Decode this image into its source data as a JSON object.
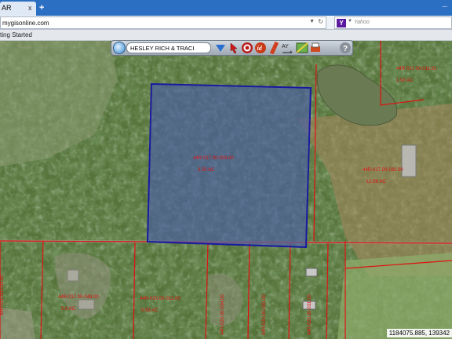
{
  "browser": {
    "tab_title": "AR",
    "tab_close": "x",
    "new_tab": "+",
    "url": "mygisonline.com",
    "search_engine_badge": "Y",
    "search_placeholder": "Yahoo",
    "bookmark_item": "ting Started"
  },
  "toolbar": {
    "search_value": "HESLEY RICH & TRACI",
    "icons": [
      "search-icon",
      "pointer-icon",
      "identify-target-icon",
      "identify-id-icon",
      "measure-ruler-icon",
      "label-ay-icon",
      "layers-map-icon",
      "print-icon",
      "help-icon"
    ],
    "help_label": "?",
    "id_label": "id"
  },
  "map": {
    "coordinates": "1184075.885, 139342",
    "parcel_labels": [
      {
        "id": "44R-017.00-004.00",
        "acres": "3.50 AC"
      },
      {
        "id": "44R-017.00-011.01",
        "acres": "1.92 AC"
      },
      {
        "id": "44R-017.00-032.00",
        "acres": "12.56 AC"
      },
      {
        "id": "44R-017.00-049.00",
        "acres": "5.6 AC"
      },
      {
        "id": "44R-020.00-012.00",
        "acres": "5.93 AC"
      },
      {
        "id": "44R-020.00-033.00",
        "acres": ""
      },
      {
        "id": "44R-020.00-034.00",
        "acres": ""
      },
      {
        "id": "44R-020.00-030.00",
        "acres": ""
      },
      {
        "id": "44R-020.00-031.00",
        "acres": ""
      }
    ]
  },
  "colors": {
    "selection_fill": "#4a5ea8",
    "selection_stroke": "#1a1aa0",
    "parcel_line": "#e01010",
    "label_text": "#e01010",
    "browser_tabbar": "#2b6fc2"
  }
}
